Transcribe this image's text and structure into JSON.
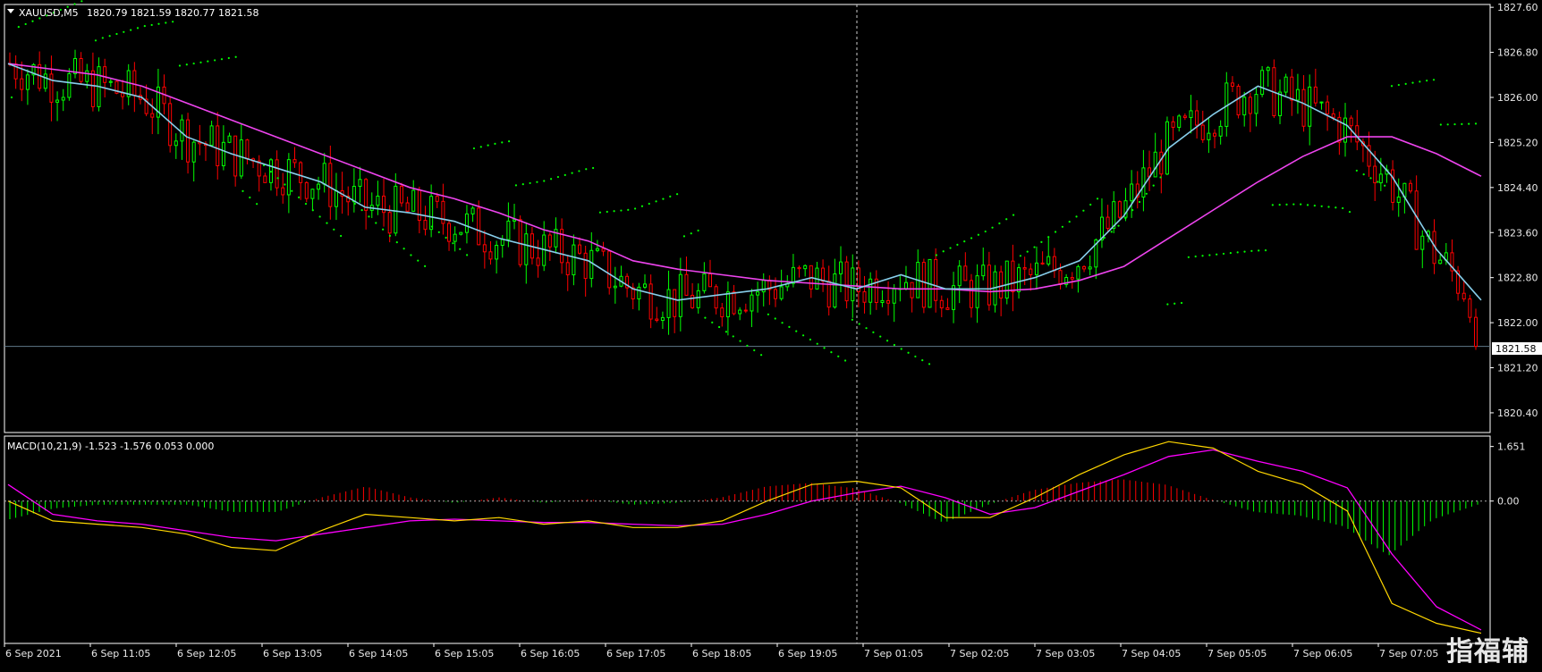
{
  "header": {
    "symbol_label": "XAUUSD,M5",
    "ohlc": "1820.79 1821.59 1820.77 1821.58"
  },
  "macd_header": "MACD(10,21,9) -1.523 -1.576 0.053 0.000",
  "watermark": "指福辅",
  "colors": {
    "background": "#000000",
    "frame": "#ffffff",
    "bull": "#00ff00",
    "bear": "#ff0000",
    "ma_fast": "#87ceeb",
    "ma_slow": "#ee44ee",
    "sar": "#00ff00",
    "macd_line": "#ffd700",
    "signal_line": "#ff00ff",
    "bid_line": "#607888",
    "crosshair": "#cccccc"
  },
  "chart_data": {
    "type": "line",
    "price_axis": {
      "ticks": [
        "1827.60",
        "1826.80",
        "1826.00",
        "1825.20",
        "1824.40",
        "1823.60",
        "1822.80",
        "1822.00",
        "1821.20",
        "1820.40"
      ],
      "range": [
        1820.05,
        1827.65
      ],
      "current_price": "1821.58"
    },
    "macd_axis": {
      "ticks": [
        "1.651",
        "0.00"
      ],
      "range": [
        -4.2,
        1.75
      ]
    },
    "time_axis": {
      "labels": [
        "6 Sep 2021",
        "6 Sep 11:05",
        "6 Sep 12:05",
        "6 Sep 13:05",
        "6 Sep 14:05",
        "6 Sep 15:05",
        "6 Sep 16:05",
        "6 Sep 17:05",
        "6 Sep 18:05",
        "6 Sep 19:05",
        "7 Sep 01:05",
        "7 Sep 02:05",
        "7 Sep 03:05",
        "7 Sep 04:05",
        "7 Sep 05:05",
        "7 Sep 06:05",
        "7 Sep 07:05"
      ]
    },
    "series": [
      {
        "values": [
          1826.6,
          1826.3,
          1826.2,
          1826.0,
          1825.3,
          1825.0,
          1824.75,
          1824.5,
          1824.05,
          1823.95,
          1823.8,
          1823.5,
          1823.3,
          1823.1,
          1822.6,
          1822.4,
          1822.5,
          1822.6,
          1822.8,
          1822.6,
          1822.85,
          1822.6,
          1822.6,
          1822.8,
          1823.1,
          1823.9,
          1825.1,
          1825.7,
          1826.2,
          1825.9,
          1825.5,
          1824.6,
          1823.3,
          1822.4
        ]
      },
      {
        "values": [
          1826.6,
          1826.5,
          1826.4,
          1826.2,
          1825.9,
          1825.6,
          1825.3,
          1825.0,
          1824.7,
          1824.4,
          1824.2,
          1823.95,
          1823.65,
          1823.45,
          1823.1,
          1822.95,
          1822.85,
          1822.75,
          1822.7,
          1822.65,
          1822.6,
          1822.6,
          1822.55,
          1822.6,
          1822.75,
          1823.0,
          1823.5,
          1824.0,
          1824.5,
          1824.95,
          1825.3,
          1825.3,
          1825.0,
          1824.6
        ]
      },
      {
        "values": [
          0.0,
          -0.6,
          -0.7,
          -0.8,
          -1.0,
          -1.4,
          -1.5,
          -0.9,
          -0.4,
          -0.5,
          -0.6,
          -0.5,
          -0.7,
          -0.6,
          -0.8,
          -0.8,
          -0.6,
          0.0,
          0.5,
          0.6,
          0.4,
          -0.5,
          -0.5,
          0.1,
          0.8,
          1.4,
          1.8,
          1.6,
          0.9,
          0.5,
          -0.3,
          -3.1,
          -3.7,
          -4.0
        ]
      },
      {
        "values": [
          0.5,
          -0.4,
          -0.6,
          -0.7,
          -0.9,
          -1.1,
          -1.2,
          -1.0,
          -0.8,
          -0.6,
          -0.55,
          -0.6,
          -0.65,
          -0.65,
          -0.7,
          -0.75,
          -0.7,
          -0.4,
          0.0,
          0.25,
          0.45,
          0.1,
          -0.4,
          -0.2,
          0.3,
          0.8,
          1.35,
          1.55,
          1.2,
          0.9,
          0.4,
          -1.6,
          -3.2,
          -3.9
        ]
      }
    ]
  }
}
